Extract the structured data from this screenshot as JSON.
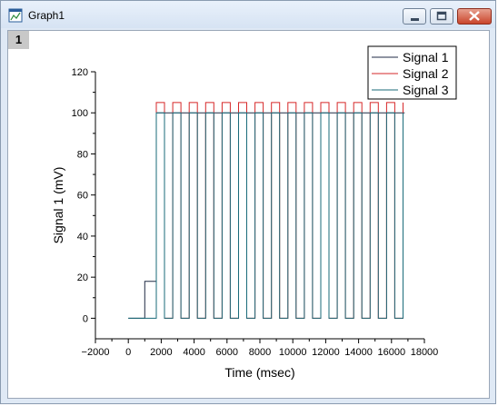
{
  "window": {
    "title": "Graph1",
    "layer_label": "1",
    "icons": [
      "graph-window-icon",
      "minimize-icon",
      "maximize-icon",
      "close-icon"
    ]
  },
  "chart_data": {
    "type": "line",
    "xlabel": "Time (msec)",
    "ylabel": "Signal 1 (mV)",
    "xlim": [
      -2000,
      18000
    ],
    "ylim": [
      -10,
      120
    ],
    "xticks": [
      -2000,
      0,
      2000,
      4000,
      6000,
      8000,
      10000,
      12000,
      14000,
      16000,
      18000
    ],
    "xtick_labels": [
      "−2000",
      "0",
      "2000",
      "4000",
      "6000",
      "8000",
      "10000",
      "12000",
      "14000",
      "16000",
      "18000"
    ],
    "yticks": [
      0,
      20,
      40,
      60,
      80,
      100,
      120
    ],
    "ytick_labels": [
      "0",
      "20",
      "40",
      "60",
      "80",
      "100",
      "120"
    ],
    "grid": false,
    "legend_position": "top-right",
    "series": [
      {
        "name": "Signal 1",
        "color": "#1f2a44",
        "x": [
          0,
          1000,
          1000,
          1700,
          1700,
          16800
        ],
        "y": [
          0,
          0,
          18,
          18,
          100,
          100
        ]
      },
      {
        "name": "Signal 2",
        "color": "#d62728",
        "x": [
          1700,
          1700,
          2200,
          2200,
          2700,
          2700,
          3200,
          3200,
          3700,
          3700,
          4200,
          4200,
          4700,
          4700,
          5200,
          5200,
          5700,
          5700,
          6200,
          6200,
          6700,
          6700,
          7200,
          7200,
          7700,
          7700,
          8200,
          8200,
          8700,
          8700,
          9200,
          9200,
          9700,
          9700,
          10200,
          10200,
          10700,
          10700,
          11200,
          11200,
          11700,
          11700,
          12200,
          12200,
          12700,
          12700,
          13200,
          13200,
          13700,
          13700,
          14200,
          14200,
          14700,
          14700,
          15200,
          15200,
          15700,
          15700,
          16200,
          16200,
          16700,
          16700
        ],
        "y": [
          0,
          105,
          105,
          0,
          0,
          105,
          105,
          0,
          0,
          105,
          105,
          0,
          0,
          105,
          105,
          0,
          0,
          105,
          105,
          0,
          0,
          105,
          105,
          0,
          0,
          105,
          105,
          0,
          0,
          105,
          105,
          0,
          0,
          105,
          105,
          0,
          0,
          105,
          105,
          0,
          0,
          105,
          105,
          0,
          0,
          105,
          105,
          0,
          0,
          105,
          105,
          0,
          0,
          105,
          105,
          0,
          0,
          105,
          105,
          0,
          0,
          105
        ]
      },
      {
        "name": "Signal 3",
        "color": "#1a6b7a",
        "x": [
          0,
          1700,
          1700,
          2200,
          2200,
          2700,
          2700,
          3200,
          3200,
          3700,
          3700,
          4200,
          4200,
          4700,
          4700,
          5200,
          5200,
          5700,
          5700,
          6200,
          6200,
          6700,
          6700,
          7200,
          7200,
          7700,
          7700,
          8200,
          8200,
          8700,
          8700,
          9200,
          9200,
          9700,
          9700,
          10200,
          10200,
          10700,
          10700,
          11200,
          11200,
          11700,
          11700,
          12200,
          12200,
          12700,
          12700,
          13200,
          13200,
          13700,
          13700,
          14200,
          14200,
          14700,
          14700,
          15200,
          15200,
          15700,
          15700,
          16200,
          16200,
          16700,
          16700
        ],
        "y": [
          0,
          0,
          100,
          100,
          0,
          0,
          100,
          100,
          0,
          0,
          100,
          100,
          0,
          0,
          100,
          100,
          0,
          0,
          100,
          100,
          0,
          0,
          100,
          100,
          0,
          0,
          100,
          100,
          0,
          0,
          100,
          100,
          0,
          0,
          100,
          100,
          0,
          0,
          100,
          100,
          0,
          0,
          100,
          100,
          0,
          0,
          100,
          100,
          0,
          0,
          100,
          100,
          0,
          0,
          100,
          100,
          0,
          0,
          100,
          100,
          0,
          0,
          100
        ]
      }
    ]
  }
}
